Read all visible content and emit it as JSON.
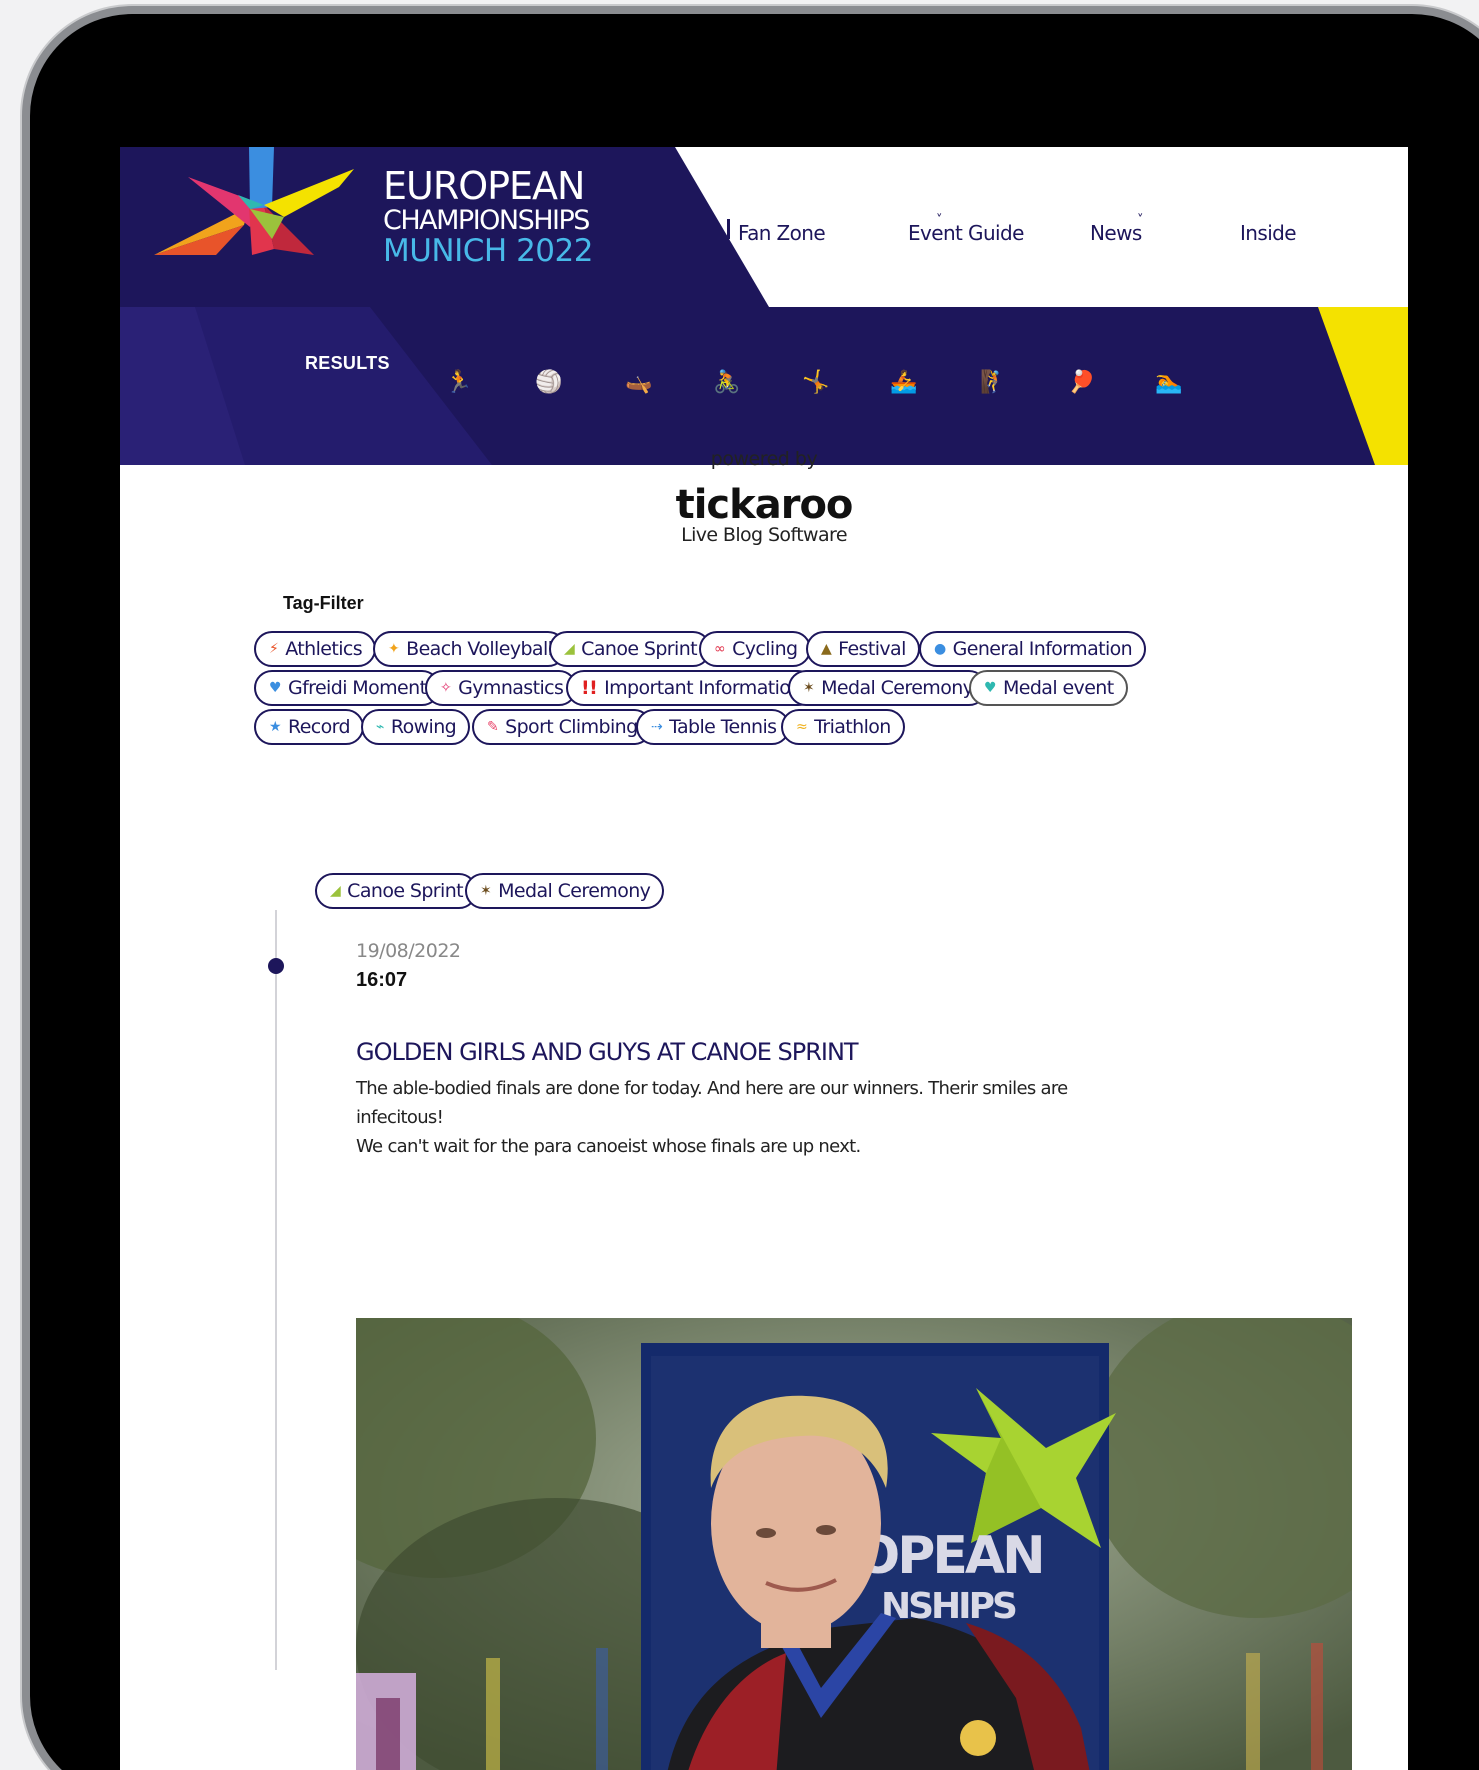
{
  "logo": {
    "line1": "EUROPEAN",
    "line2": "CHAMPIONSHIPS",
    "line3": "MUNICH 2022"
  },
  "nav": {
    "items": [
      {
        "label": "Fan Zone",
        "has_dropdown": true
      },
      {
        "label": "Event Guide",
        "has_dropdown": true
      },
      {
        "label": "News",
        "has_dropdown": false
      },
      {
        "label": "Inside",
        "has_dropdown": false
      }
    ],
    "chevron": "˅"
  },
  "sports_bar": {
    "results_label": "RESULTS",
    "icons": [
      {
        "name": "athletics-icon",
        "glyph": "🏃",
        "color": "#e8542a"
      },
      {
        "name": "beach-volleyball-icon",
        "glyph": "🏐",
        "color": "#f1a31c"
      },
      {
        "name": "canoe-sprint-icon",
        "glyph": "🛶",
        "color": "#9bc23c"
      },
      {
        "name": "cycling-icon",
        "glyph": "🚴",
        "color": "#e1354d"
      },
      {
        "name": "gymnastics-icon",
        "glyph": "🤸",
        "color": "#e2366f"
      },
      {
        "name": "rowing-icon",
        "glyph": "🚣",
        "color": "#2fb8b0"
      },
      {
        "name": "sport-climbing-icon",
        "glyph": "🧗",
        "color": "#e8466b"
      },
      {
        "name": "table-tennis-icon",
        "glyph": "🏓",
        "color": "#3b8ee0"
      },
      {
        "name": "triathlon-icon",
        "glyph": "🏊",
        "color": "#f0b21e"
      }
    ]
  },
  "powered": {
    "text": "powered by",
    "brand": "tickaroo",
    "tagline": "Live Blog Software"
  },
  "tag_filter": {
    "title": "Tag-Filter",
    "tags": [
      {
        "label": "Athletics",
        "icon": "athletics-icon",
        "glyph": "⚡",
        "color": "#e8542a"
      },
      {
        "label": "Beach Volleyball",
        "icon": "beach-volleyball-icon",
        "glyph": "✦",
        "color": "#f1a31c"
      },
      {
        "label": "Canoe Sprint",
        "icon": "canoe-sprint-icon",
        "glyph": "◢",
        "color": "#9bc23c"
      },
      {
        "label": "Cycling",
        "icon": "cycling-icon",
        "glyph": "∞",
        "color": "#e1354d"
      },
      {
        "label": "Festival",
        "icon": "festival-icon",
        "glyph": "▲",
        "color": "#8a6a1c"
      },
      {
        "label": "General Information",
        "icon": "info-icon",
        "glyph": "●",
        "color": "#3b8ee0"
      },
      {
        "label": "Gfreidi Moment",
        "icon": "mascot-icon",
        "glyph": "♥",
        "color": "#3b8ee0"
      },
      {
        "label": "Gymnastics",
        "icon": "gymnastics-icon",
        "glyph": "✧",
        "color": "#e2366f"
      },
      {
        "label": "Important Information",
        "icon": "exclamation-icon",
        "glyph": "!!",
        "color": "#e02020"
      },
      {
        "label": "Medal Ceremony",
        "icon": "medal-ceremony-icon",
        "glyph": "✶",
        "color": "#6b4b1c"
      },
      {
        "label": "Medal event",
        "icon": "medal-icon",
        "glyph": "♥",
        "color": "#2fb8b0"
      },
      {
        "label": "Record",
        "icon": "star-icon",
        "glyph": "★",
        "color": "#3b8ee0"
      },
      {
        "label": "Rowing",
        "icon": "rowing-icon",
        "glyph": "⌁",
        "color": "#2fb8b0"
      },
      {
        "label": "Sport Climbing",
        "icon": "sport-climbing-icon",
        "glyph": "✎",
        "color": "#e8466b"
      },
      {
        "label": "Table Tennis",
        "icon": "table-tennis-icon",
        "glyph": "⇢",
        "color": "#3b8ee0"
      },
      {
        "label": "Triathlon",
        "icon": "triathlon-icon",
        "glyph": "≈",
        "color": "#f0b21e"
      }
    ]
  },
  "entry": {
    "tags": [
      {
        "label": "Canoe Sprint",
        "glyph": "◢",
        "color": "#9bc23c"
      },
      {
        "label": "Medal Ceremony",
        "glyph": "✶",
        "color": "#6b4b1c"
      }
    ],
    "date": "19/08/2022",
    "time": "16:07",
    "title": "GOLDEN GIRLS AND GUYS AT CANOE SPRINT",
    "body_line1": "The able-bodied finals are done for today. And here are our winners. Therir smiles are infecitous!",
    "body_line2": "We can't wait for the para canoeist whose finals are up next.",
    "photo_banner_text1": "OPEAN",
    "photo_banner_text2": "NSHIPS"
  },
  "colors": {
    "navy": "#1d165b",
    "yellow": "#f4e200",
    "light_blue": "#48b9e8"
  }
}
